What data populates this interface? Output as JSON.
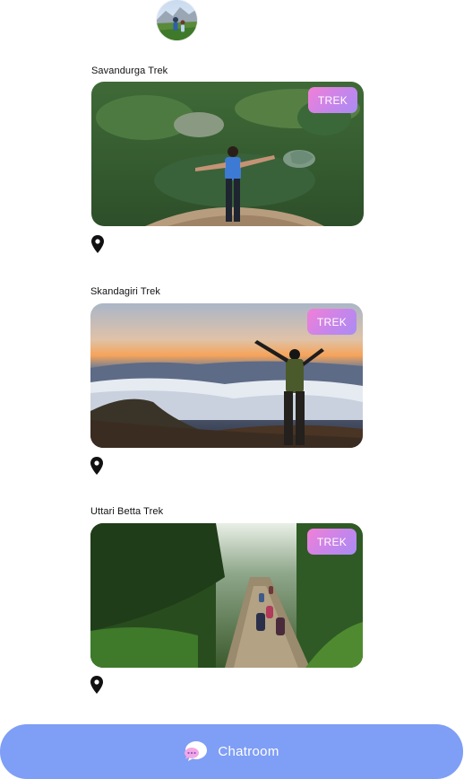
{
  "treks": [
    {
      "title": "Savandurga Trek",
      "tag": "TREK"
    },
    {
      "title": "Skandagiri Trek",
      "tag": "TREK"
    },
    {
      "title": "Uttari Betta Trek",
      "tag": "TREK"
    }
  ],
  "chat": {
    "label": "Chatroom"
  },
  "colors": {
    "chat_bar": "#7f9ef5",
    "tag_gradient_start": "#f27fd7",
    "tag_gradient_end": "#a98cf3"
  },
  "icons": {
    "avatar": "profile-avatar",
    "location": "location-pin-icon",
    "chat": "chat-bubble-icon"
  }
}
